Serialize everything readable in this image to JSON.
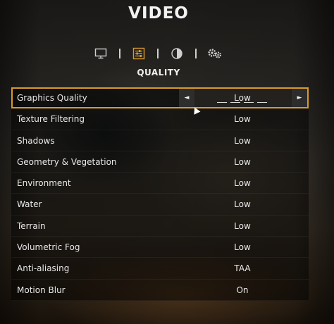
{
  "header": {
    "title": "VIDEO"
  },
  "tabs": [
    {
      "icon": "monitor-icon",
      "active": false
    },
    {
      "icon": "quality-sliders-icon",
      "active": true
    },
    {
      "icon": "contrast-icon",
      "active": false
    },
    {
      "icon": "gears-icon",
      "active": false
    }
  ],
  "section": {
    "title": "QUALITY"
  },
  "settings": [
    {
      "label": "Graphics Quality",
      "value": "Low",
      "selected": true
    },
    {
      "label": "Texture Filtering",
      "value": "Low"
    },
    {
      "label": "Shadows",
      "value": "Low"
    },
    {
      "label": "Geometry & Vegetation",
      "value": "Low"
    },
    {
      "label": "Environment",
      "value": "Low"
    },
    {
      "label": "Water",
      "value": "Low"
    },
    {
      "label": "Terrain",
      "value": "Low"
    },
    {
      "label": "Volumetric Fog",
      "value": "Low"
    },
    {
      "label": "Anti-aliasing",
      "value": "TAA"
    },
    {
      "label": "Motion Blur",
      "value": "On"
    }
  ],
  "selector": {
    "left_arrow": "◄",
    "right_arrow": "►"
  },
  "colors": {
    "accent": "#d89a2c",
    "text": "#e8e8e8",
    "row_bg": "rgba(0,0,0,0.48)"
  }
}
